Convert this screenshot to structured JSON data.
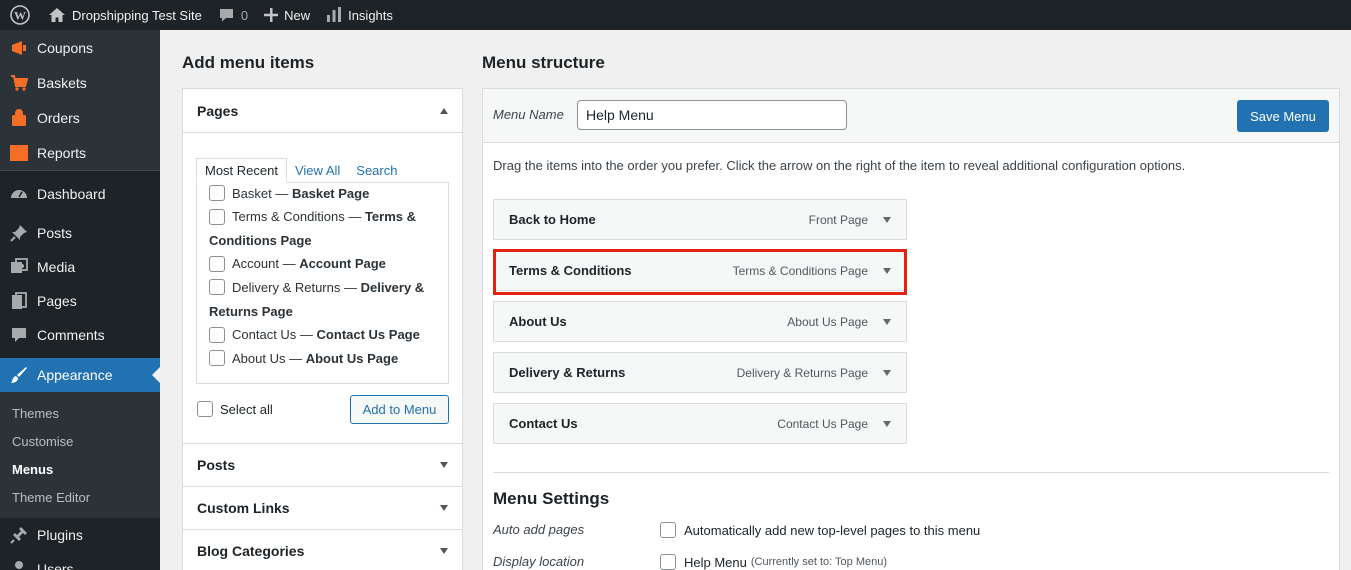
{
  "adminbar": {
    "site_name": "Dropshipping Test Site",
    "comments_count": "0",
    "new_label": "New",
    "insights_label": "Insights"
  },
  "sidebar": {
    "woo_items": [
      {
        "label": "Coupons",
        "icon": "megaphone-icon"
      },
      {
        "label": "Baskets",
        "icon": "cart-icon"
      },
      {
        "label": "Orders",
        "icon": "bag-icon"
      },
      {
        "label": "Reports",
        "icon": "reports-icon"
      }
    ],
    "dashboard": "Dashboard",
    "posts": "Posts",
    "media": "Media",
    "pages": "Pages",
    "comments": "Comments",
    "appearance": "Appearance",
    "submenu": [
      "Themes",
      "Customise",
      "Menus",
      "Theme Editor"
    ],
    "plugins": "Plugins",
    "users": "Users"
  },
  "add_items": {
    "title": "Add menu items",
    "pages_section": "Pages",
    "tabs": [
      "Most Recent",
      "View All",
      "Search"
    ],
    "pages_list": [
      {
        "name": "Basket",
        "tag": "Basket Page"
      },
      {
        "name": "Terms & Conditions",
        "tag": "Terms & Conditions Page"
      },
      {
        "name": "Account",
        "tag": "Account Page"
      },
      {
        "name": "Delivery & Returns",
        "tag": "Delivery & Returns Page"
      },
      {
        "name": "Contact Us",
        "tag": "Contact Us Page"
      },
      {
        "name": "About Us",
        "tag": "About Us Page"
      }
    ],
    "select_all": "Select all",
    "add_button": "Add to Menu",
    "other_sections": [
      "Posts",
      "Custom Links",
      "Blog Categories"
    ]
  },
  "structure": {
    "title": "Menu structure",
    "menu_name_label": "Menu Name",
    "menu_name_value": "Help Menu",
    "save_button": "Save Menu",
    "instructions": "Drag the items into the order you prefer. Click the arrow on the right of the item to reveal additional configuration options.",
    "items": [
      {
        "title": "Back to Home",
        "type": "Front Page"
      },
      {
        "title": "Terms & Conditions",
        "type": "Terms & Conditions Page"
      },
      {
        "title": "About Us",
        "type": "About Us Page"
      },
      {
        "title": "Delivery & Returns",
        "type": "Delivery & Returns Page"
      },
      {
        "title": "Contact Us",
        "type": "Contact Us Page"
      }
    ],
    "highlight_color": "#e2230f"
  },
  "settings": {
    "title": "Menu Settings",
    "auto_add_label": "Auto add pages",
    "auto_add_option": "Automatically add new top-level pages to this menu",
    "display_location_label": "Display location",
    "location_option": "Help Menu",
    "location_note": "(Currently set to: Top Menu)"
  },
  "colors": {
    "admin_dark": "#1d2327",
    "accent_blue": "#2271b1",
    "woo_orange": "#f56e28"
  }
}
